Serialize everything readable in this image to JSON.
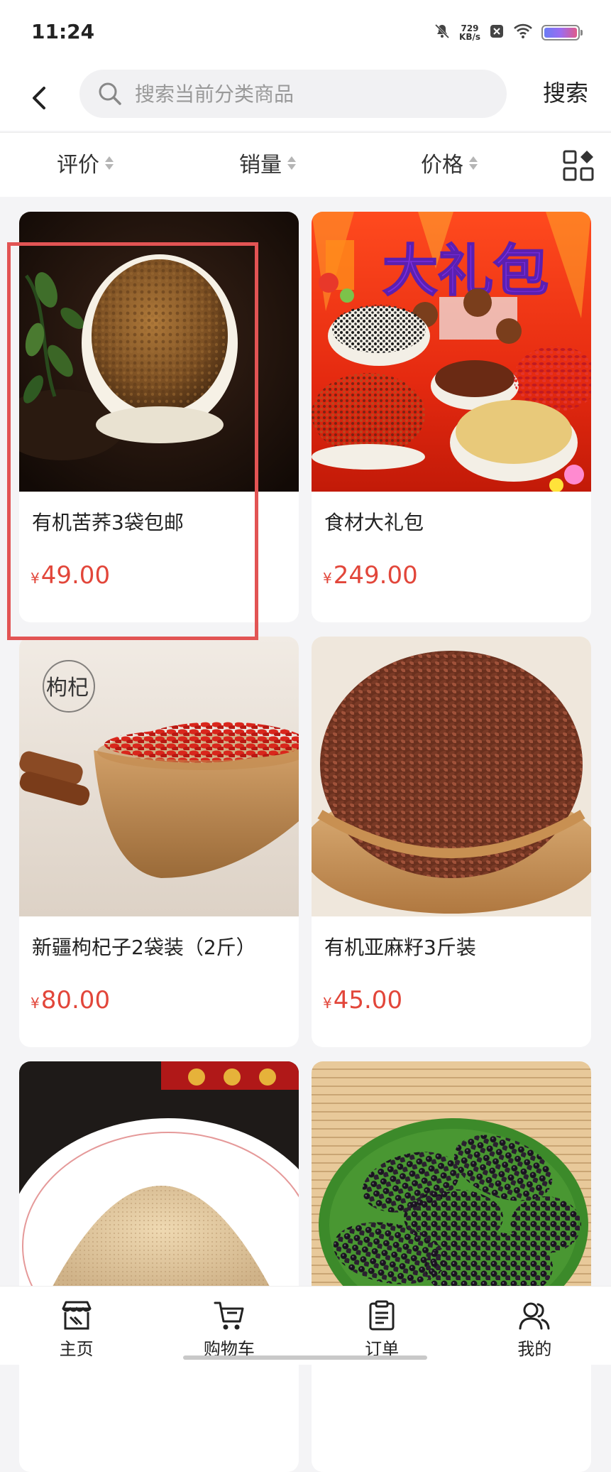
{
  "status_bar": {
    "time": "11:24",
    "network_speed_value": "729",
    "network_speed_unit": "KB/s",
    "icons": [
      "mute-icon",
      "network-speed",
      "sim-off-icon",
      "wifi-icon",
      "battery-icon"
    ]
  },
  "header": {
    "back_icon": "chevron-left-icon",
    "search_icon": "search-icon",
    "search_placeholder": "搜索当前分类商品",
    "search_button_label": "搜索"
  },
  "sort_bar": {
    "items": [
      {
        "label": "评价",
        "icon": "sort-arrows-icon"
      },
      {
        "label": "销量",
        "icon": "sort-arrows-icon"
      },
      {
        "label": "价格",
        "icon": "sort-arrows-icon"
      }
    ],
    "layout_toggle_icon": "grid-layout-icon"
  },
  "products": [
    {
      "title": "有机苦荞3袋包邮",
      "currency": "¥",
      "price": "49.00",
      "image": "buckwheat-bowl"
    },
    {
      "title": "食材大礼包",
      "currency": "¥",
      "price": "249.00",
      "image": "gift-package",
      "image_overlay_text": "大礼包"
    },
    {
      "title": "新疆枸杞子2袋装（2斤）",
      "currency": "¥",
      "price": "80.00",
      "image": "goji-bowl",
      "image_overlay_text": "枸杞"
    },
    {
      "title": "有机亚麻籽3斤装",
      "currency": "¥",
      "price": "45.00",
      "image": "flaxseed-bowl"
    },
    {
      "title": "",
      "currency": "",
      "price": "",
      "image": "flour-plate"
    },
    {
      "title": "",
      "currency": "",
      "price": "",
      "image": "mulberries"
    }
  ],
  "bottom_nav": {
    "items": [
      {
        "label": "主页",
        "icon": "store-icon"
      },
      {
        "label": "购物车",
        "icon": "cart-icon"
      },
      {
        "label": "订单",
        "icon": "order-list-icon"
      },
      {
        "label": "我的",
        "icon": "user-icon"
      }
    ]
  },
  "colors": {
    "price": "#e2463a",
    "highlight": "#e25454",
    "background": "#f4f4f6"
  }
}
